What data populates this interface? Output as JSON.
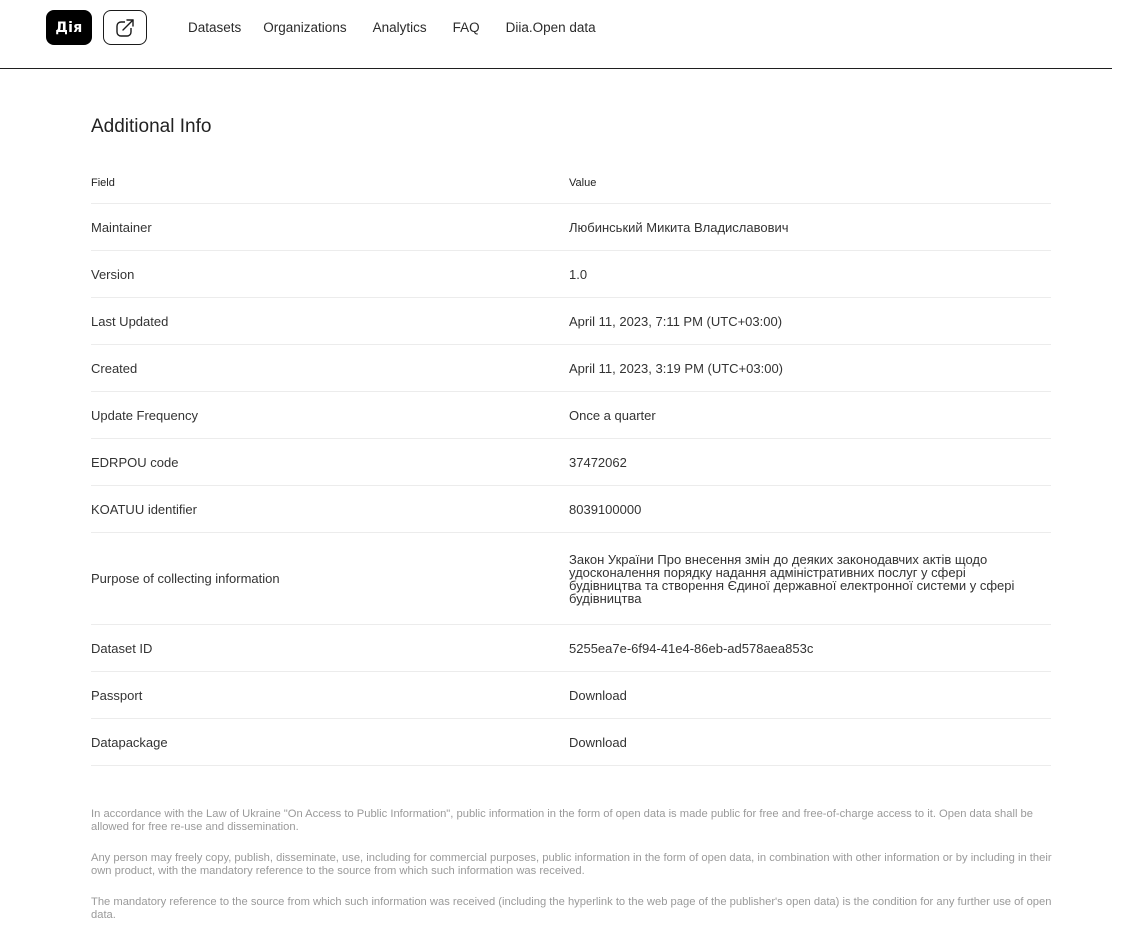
{
  "header": {
    "logo_text": "Дія",
    "nav": [
      {
        "label": "Datasets"
      },
      {
        "label": "Organizations"
      },
      {
        "label": "Analytics"
      },
      {
        "label": "FAQ"
      },
      {
        "label": "Diia.Open data"
      }
    ]
  },
  "section": {
    "title": "Additional Info",
    "columns": {
      "field": "Field",
      "value": "Value"
    },
    "rows": [
      {
        "field": "Maintainer",
        "value": "Любинський Микита Владиславович"
      },
      {
        "field": "Version",
        "value": "1.0"
      },
      {
        "field": "Last Updated",
        "value": "April 11, 2023, 7:11 PM (UTC+03:00)"
      },
      {
        "field": "Created",
        "value": "April 11, 2023, 3:19 PM (UTC+03:00)"
      },
      {
        "field": "Update Frequency",
        "value": "Once a quarter"
      },
      {
        "field": "EDRPOU code",
        "value": "37472062"
      },
      {
        "field": "KOATUU identifier",
        "value": "8039100000"
      },
      {
        "field": "Purpose of collecting information",
        "value": "Закон України Про внесення змін до деяких законодавчих актів щодо удосконалення порядку надання адміністративних послуг у сфері будівництва та створення Єдиної державної електронної системи у сфері будівництва"
      },
      {
        "field": "Dataset ID",
        "value": "5255ea7e-6f94-41e4-86eb-ad578aea853c"
      },
      {
        "field": "Passport",
        "value": "Download"
      },
      {
        "field": "Datapackage",
        "value": "Download"
      }
    ]
  },
  "legal": [
    "In accordance with the Law of Ukraine \"On Access to Public Information\", public information in the form of open data is made public for free and free-of-charge access to it. Open data shall be allowed for free re-use and dissemination.",
    "Any person may freely copy, publish, disseminate, use, including for commercial purposes, public information in the form of open data, in combination with other information or by including in their own product, with the mandatory reference to the source from which such information was received.",
    "The mandatory reference to the source from which such information was received (including the hyperlink to the web page of the publisher's open data) is the condition for any further use of open data."
  ]
}
